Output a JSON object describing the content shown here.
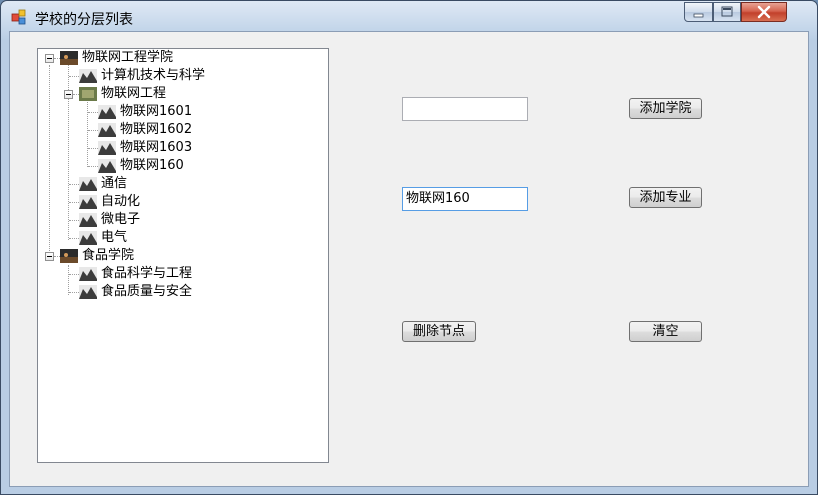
{
  "window": {
    "title": "学校的分层列表",
    "icons": {
      "app": "app-icon",
      "minimize": "minimize-icon",
      "maximize": "maximize-icon",
      "close": "close-icon"
    }
  },
  "tree": {
    "nodes": [
      {
        "label": "物联网工程学院",
        "expanded": true,
        "icon": "college-image-icon",
        "children": [
          {
            "label": "计算机技术与科学",
            "icon": "major-image-icon"
          },
          {
            "label": "物联网工程",
            "expanded": true,
            "icon": "major-image-icon",
            "children": [
              {
                "label": "物联网1601",
                "icon": "class-image-icon"
              },
              {
                "label": "物联网1602",
                "icon": "class-image-icon"
              },
              {
                "label": "物联网1603",
                "icon": "class-image-icon"
              },
              {
                "label": "物联网160",
                "icon": "class-image-icon"
              }
            ]
          },
          {
            "label": "通信",
            "icon": "major-image-icon"
          },
          {
            "label": "自动化",
            "icon": "major-image-icon"
          },
          {
            "label": "微电子",
            "icon": "major-image-icon"
          },
          {
            "label": "电气",
            "icon": "major-image-icon"
          }
        ]
      },
      {
        "label": "食品学院",
        "expanded": true,
        "icon": "college-image-icon",
        "children": [
          {
            "label": "食品科学与工程",
            "icon": "major-image-icon"
          },
          {
            "label": "食品质量与安全",
            "icon": "major-image-icon"
          }
        ]
      }
    ]
  },
  "form": {
    "college_input_value": "",
    "major_input_value": "物联网160",
    "add_college_label": "添加学院",
    "add_major_label": "添加专业",
    "delete_node_label": "删除节点",
    "clear_label": "清空"
  }
}
